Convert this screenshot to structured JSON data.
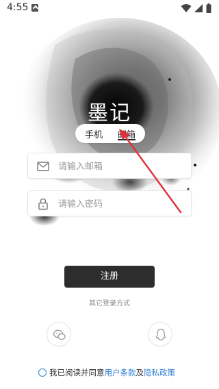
{
  "status_bar": {
    "time": "4:55",
    "icons": [
      "notification-icon",
      "wifi-icon",
      "signal-icon",
      "battery-icon"
    ]
  },
  "app": {
    "title": "墨记"
  },
  "login_toggle": {
    "phone_label": "手机",
    "email_label": "邮箱",
    "selected": "邮箱"
  },
  "form": {
    "email": {
      "value": "",
      "placeholder": "请输入邮箱",
      "icon": "mail-icon"
    },
    "password": {
      "value": "",
      "placeholder": "请输入密码",
      "icon": "lock-icon"
    },
    "submit_label": "注册"
  },
  "other_login": {
    "label": "其它登录方式",
    "options": [
      {
        "icon": "wechat-icon"
      },
      {
        "icon": "qq-icon"
      }
    ]
  },
  "agreement": {
    "checked": false,
    "prefix": "我已阅读并同意",
    "terms_label": "用户条款",
    "connector": "及",
    "privacy_label": "隐私政策"
  },
  "colors": {
    "primary_button": "#2d2d2d",
    "link": "#2f7fd1",
    "arrow": "#e0303a"
  }
}
